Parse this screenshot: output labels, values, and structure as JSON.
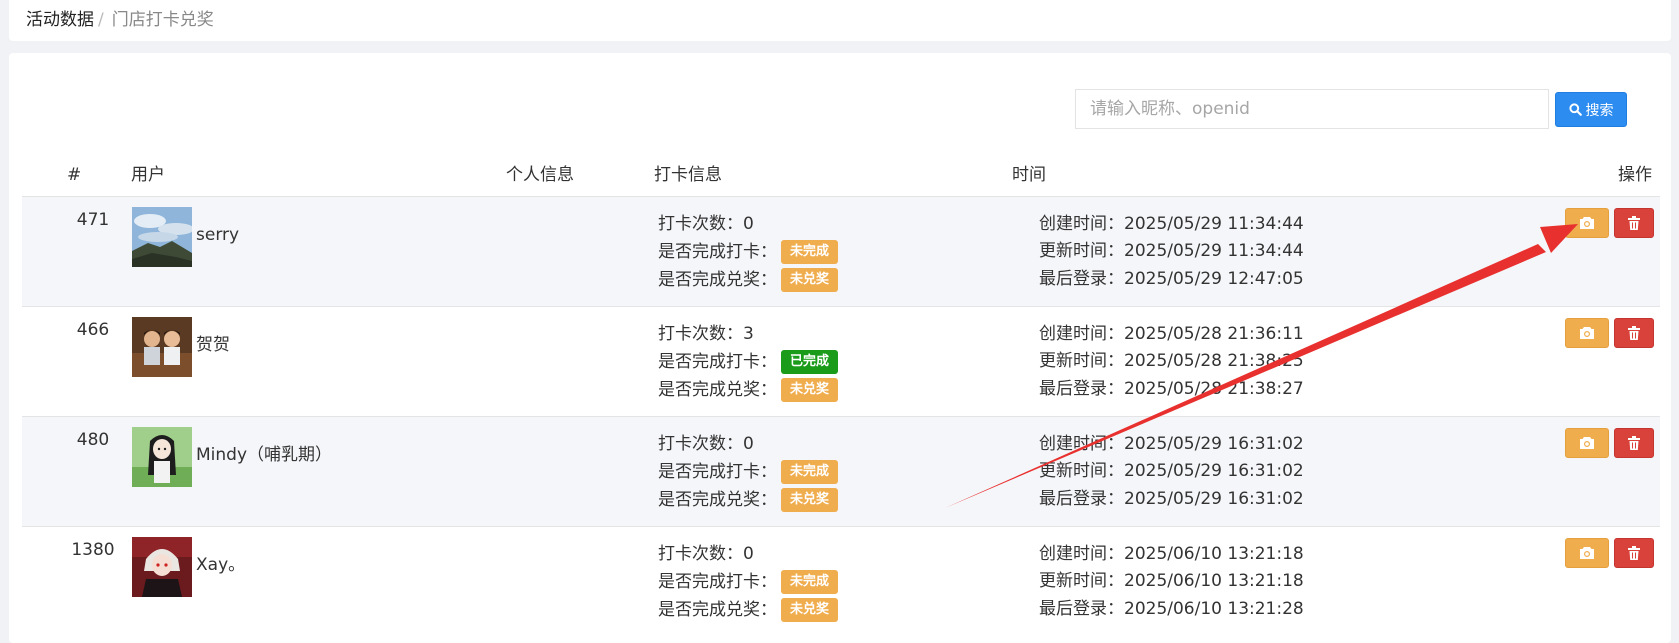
{
  "breadcrumb": {
    "items": [
      "活动数据",
      "门店打卡兑奖"
    ],
    "separator": "/"
  },
  "search": {
    "placeholder": "请输入昵称、openid",
    "button_label": "搜索"
  },
  "table": {
    "headers": [
      "#",
      "用户",
      "个人信息",
      "打卡信息",
      "时间",
      "操作"
    ],
    "labels": {
      "count": "打卡次数：",
      "checkin_done": "是否完成打卡：",
      "prize_done": "是否完成兑奖：",
      "created": "创建时间：",
      "updated": "更新时间：",
      "last_login": "最后登录："
    },
    "rows": [
      {
        "id": "471",
        "nickname": "serry",
        "count": "0",
        "checkin": "未完成",
        "prize": "未兑奖",
        "created": "2025/05/29 11:34:44",
        "updated": "2025/05/29 11:34:44",
        "last_login": "2025/05/29 12:47:05"
      },
      {
        "id": "466",
        "nickname": "贺贺",
        "count": "3",
        "checkin": "已完成",
        "prize": "未兑奖",
        "created": "2025/05/28 21:36:11",
        "updated": "2025/05/28 21:38:25",
        "last_login": "2025/05/28 21:38:27"
      },
      {
        "id": "480",
        "nickname": "Mindy（哺乳期）",
        "count": "0",
        "checkin": "未完成",
        "prize": "未兑奖",
        "created": "2025/05/29 16:31:02",
        "updated": "2025/05/29 16:31:02",
        "last_login": "2025/05/29 16:31:02"
      },
      {
        "id": "1380",
        "nickname": "Xay。",
        "count": "0",
        "checkin": "未完成",
        "prize": "未兑奖",
        "created": "2025/06/10 13:21:18",
        "updated": "2025/06/10 13:21:18",
        "last_login": "2025/06/10 13:21:28"
      }
    ]
  },
  "colors": {
    "primary": "#2d8cf0",
    "warning": "#f0ad4e",
    "success": "#1a9c1a",
    "danger": "#d9413b",
    "annotation_arrow": "#e8312f"
  },
  "icons": {
    "search": "search-icon",
    "camera": "camera-icon",
    "delete": "trash-icon"
  }
}
